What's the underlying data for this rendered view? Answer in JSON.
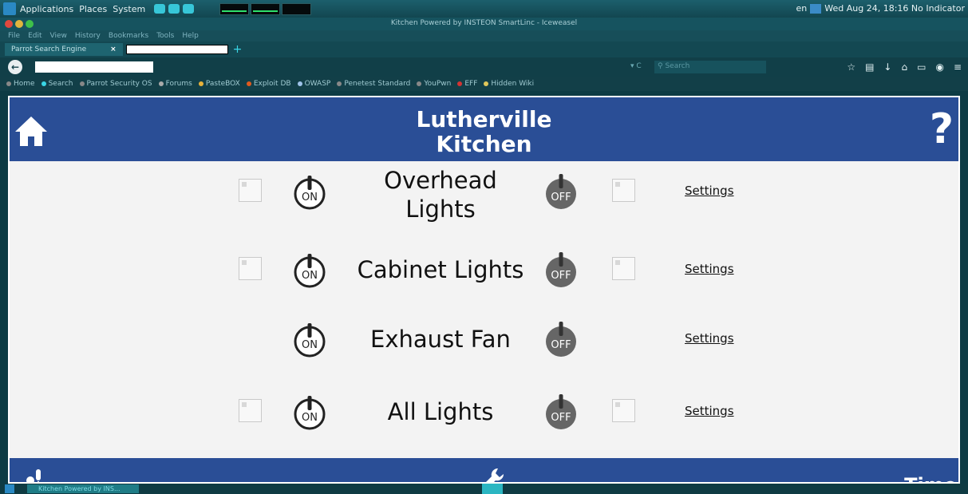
{
  "os_panel": {
    "menus": [
      "Applications",
      "Places",
      "System"
    ],
    "clock": "en",
    "datetime": "Wed Aug 24, 18:16 No Indicator"
  },
  "window": {
    "title": "Kitchen Powered by INSTEON SmartLinc - Iceweasel"
  },
  "browser": {
    "menu": [
      "File",
      "Edit",
      "View",
      "History",
      "Bookmarks",
      "Tools",
      "Help"
    ],
    "tab_label": "Parrot Search Engine",
    "tab_close": "×",
    "new_tab": "+",
    "search_placeholder": "Search",
    "reload": "▾ C",
    "bookmarks": [
      {
        "label": "Home",
        "color": "#888888"
      },
      {
        "label": "Search",
        "color": "#3ad6e6"
      },
      {
        "label": "Parrot Security OS",
        "color": "#888888"
      },
      {
        "label": "Forums",
        "color": "#aaaaaa"
      },
      {
        "label": "PasteBOX",
        "color": "#e8b23a"
      },
      {
        "label": "Exploit DB",
        "color": "#e05a1e"
      },
      {
        "label": "OWASP",
        "color": "#9fc3ea"
      },
      {
        "label": "Penetest Standard",
        "color": "#888888"
      },
      {
        "label": "YouPwn",
        "color": "#888888"
      },
      {
        "label": "EFF",
        "color": "#d33333"
      },
      {
        "label": "Hidden Wiki",
        "color": "#e0c75a"
      }
    ]
  },
  "app": {
    "title_line1": "Lutherville",
    "title_line2": "Kitchen",
    "help_label": "?",
    "footer_right": "Time",
    "devices": [
      {
        "name_line1": "Overhead",
        "name_line2": "Lights",
        "on": "ON",
        "off": "OFF",
        "settings": "Settings",
        "has_checks": true
      },
      {
        "name_line1": "Cabinet Lights",
        "name_line2": "",
        "on": "ON",
        "off": "OFF",
        "settings": "Settings",
        "has_checks": true
      },
      {
        "name_line1": "Exhaust Fan",
        "name_line2": "",
        "on": "ON",
        "off": "OFF",
        "settings": "Settings",
        "has_checks": false
      },
      {
        "name_line1": "All Lights",
        "name_line2": "",
        "on": "ON",
        "off": "OFF",
        "settings": "Settings",
        "has_checks": true
      }
    ]
  },
  "taskbar": {
    "item": "Kitchen Powered by INS..."
  },
  "colors": {
    "header_blue": "#2a4e96",
    "off_grey": "#666666"
  }
}
